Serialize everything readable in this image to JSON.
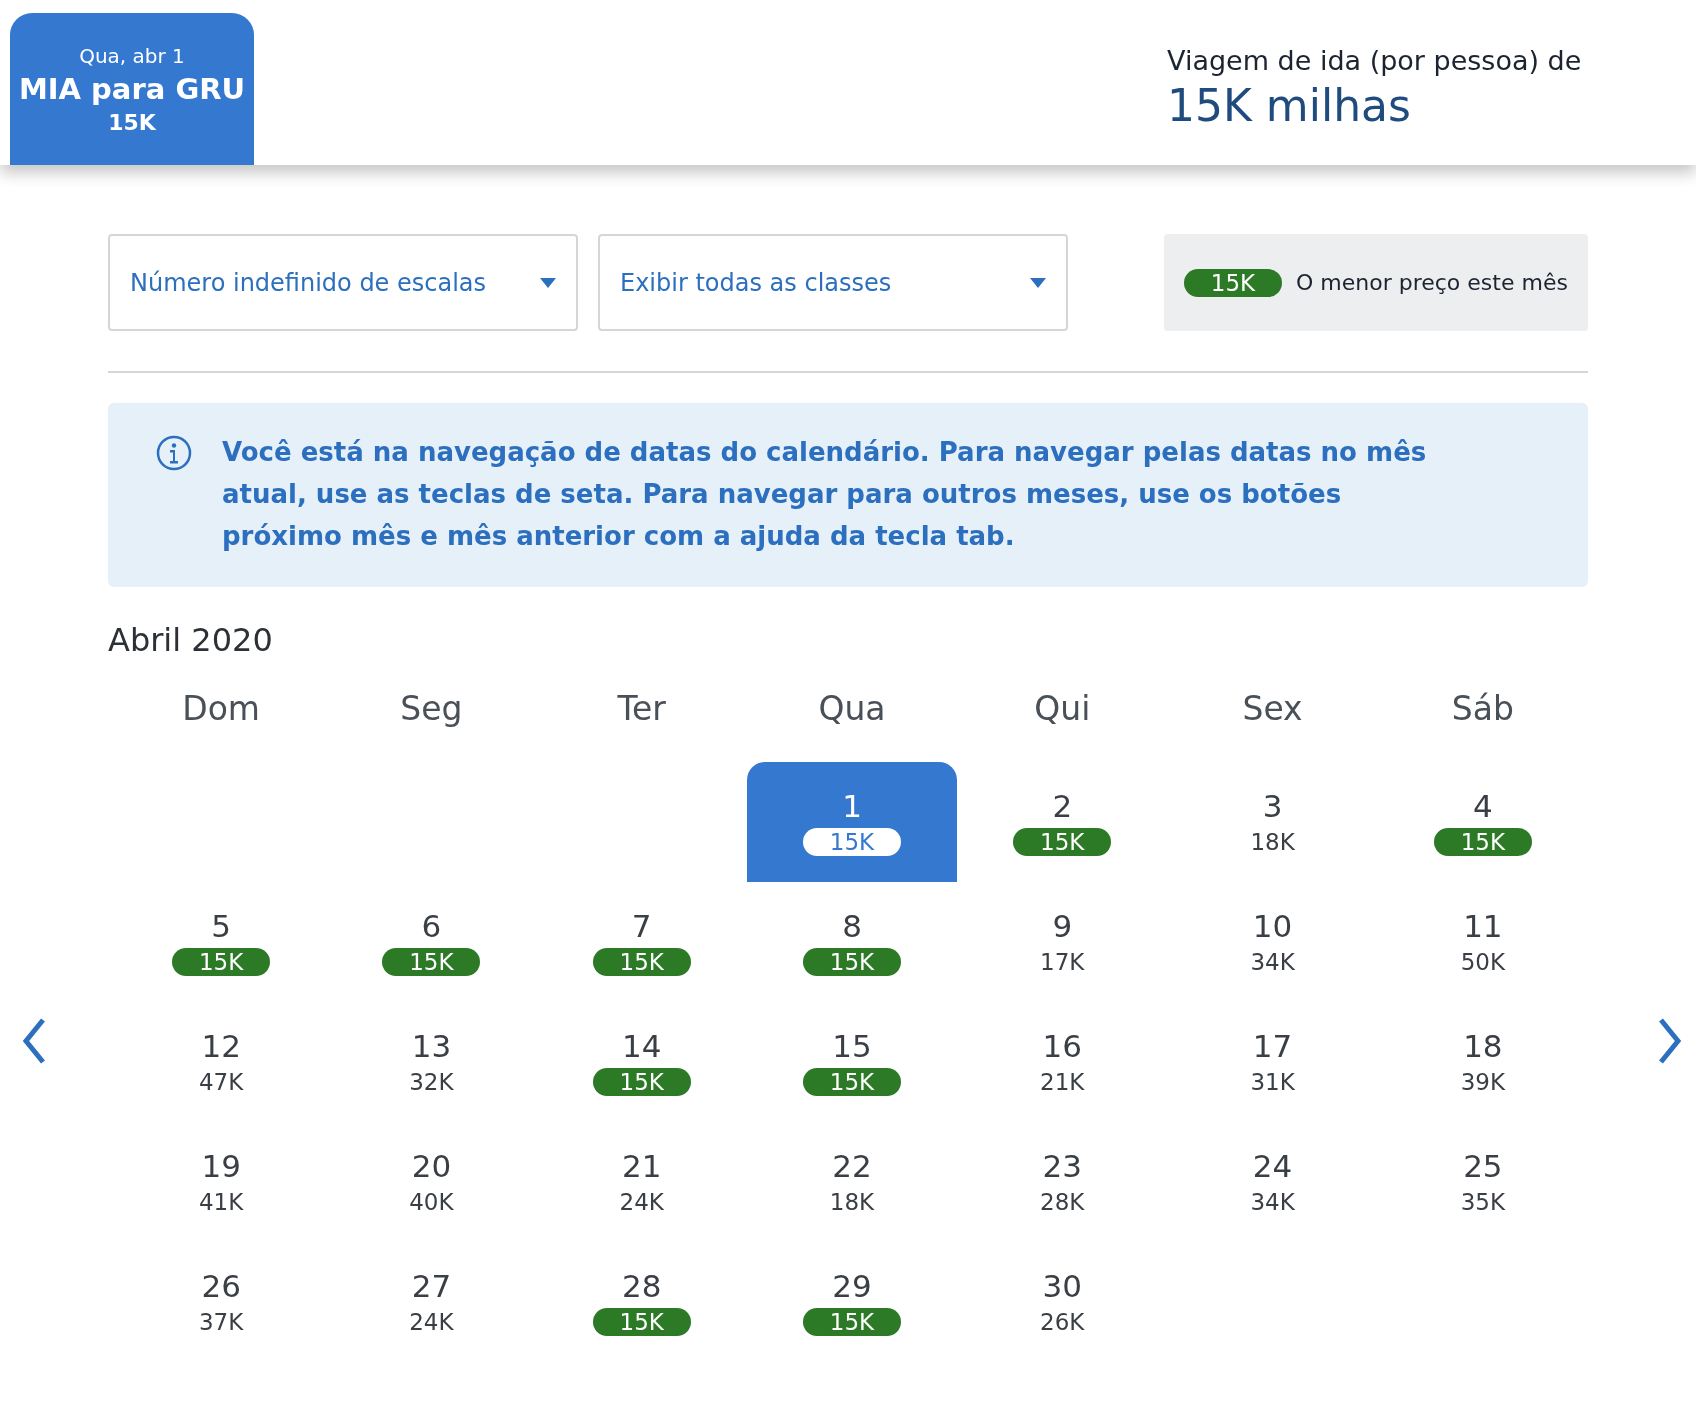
{
  "flight_tab": {
    "date": "Qua, abr 1",
    "route": "MIA para GRU",
    "price": "15K",
    "selected": true
  },
  "fare_summary": {
    "label": "Viagem de ida (por pessoa) de",
    "price": "15K milhas"
  },
  "filters": [
    {
      "value": "Número indefinido de escalas"
    },
    {
      "value": "Exibir todas as classes"
    }
  ],
  "legend": {
    "badge": "15K",
    "text": "O menor preço este mês"
  },
  "info_message": "Você está na navegação de datas do calendário. Para navegar pelas datas no mês atual, use as teclas de seta. Para navegar para outros meses, use os botões próximo mês e mês anterior com a ajuda da tecla tab.",
  "calendar": {
    "month": "Abril 2020",
    "weekdays": [
      "Dom",
      "Seg",
      "Ter",
      "Qua",
      "Qui",
      "Sex",
      "Sáb"
    ],
    "weeks": [
      [
        {
          "kind": "empty"
        },
        {
          "kind": "empty"
        },
        {
          "kind": "empty"
        },
        {
          "kind": "day",
          "day": "1",
          "price": "15K",
          "lowest": true,
          "selected": true
        },
        {
          "kind": "day",
          "day": "2",
          "price": "15K",
          "lowest": true,
          "selected": false
        },
        {
          "kind": "day",
          "day": "3",
          "price": "18K",
          "lowest": false,
          "selected": false
        },
        {
          "kind": "day",
          "day": "4",
          "price": "15K",
          "lowest": true,
          "selected": false
        }
      ],
      [
        {
          "kind": "day",
          "day": "5",
          "price": "15K",
          "lowest": true,
          "selected": false
        },
        {
          "kind": "day",
          "day": "6",
          "price": "15K",
          "lowest": true,
          "selected": false
        },
        {
          "kind": "day",
          "day": "7",
          "price": "15K",
          "lowest": true,
          "selected": false
        },
        {
          "kind": "day",
          "day": "8",
          "price": "15K",
          "lowest": true,
          "selected": false
        },
        {
          "kind": "day",
          "day": "9",
          "price": "17K",
          "lowest": false,
          "selected": false
        },
        {
          "kind": "day",
          "day": "10",
          "price": "34K",
          "lowest": false,
          "selected": false
        },
        {
          "kind": "day",
          "day": "11",
          "price": "50K",
          "lowest": false,
          "selected": false
        }
      ],
      [
        {
          "kind": "day",
          "day": "12",
          "price": "47K",
          "lowest": false,
          "selected": false
        },
        {
          "kind": "day",
          "day": "13",
          "price": "32K",
          "lowest": false,
          "selected": false
        },
        {
          "kind": "day",
          "day": "14",
          "price": "15K",
          "lowest": true,
          "selected": false
        },
        {
          "kind": "day",
          "day": "15",
          "price": "15K",
          "lowest": true,
          "selected": false
        },
        {
          "kind": "day",
          "day": "16",
          "price": "21K",
          "lowest": false,
          "selected": false
        },
        {
          "kind": "day",
          "day": "17",
          "price": "31K",
          "lowest": false,
          "selected": false
        },
        {
          "kind": "day",
          "day": "18",
          "price": "39K",
          "lowest": false,
          "selected": false
        }
      ],
      [
        {
          "kind": "day",
          "day": "19",
          "price": "41K",
          "lowest": false,
          "selected": false
        },
        {
          "kind": "day",
          "day": "20",
          "price": "40K",
          "lowest": false,
          "selected": false
        },
        {
          "kind": "day",
          "day": "21",
          "price": "24K",
          "lowest": false,
          "selected": false
        },
        {
          "kind": "day",
          "day": "22",
          "price": "18K",
          "lowest": false,
          "selected": false
        },
        {
          "kind": "day",
          "day": "23",
          "price": "28K",
          "lowest": false,
          "selected": false
        },
        {
          "kind": "day",
          "day": "24",
          "price": "34K",
          "lowest": false,
          "selected": false
        },
        {
          "kind": "day",
          "day": "25",
          "price": "35K",
          "lowest": false,
          "selected": false
        }
      ],
      [
        {
          "kind": "day",
          "day": "26",
          "price": "37K",
          "lowest": false,
          "selected": false
        },
        {
          "kind": "day",
          "day": "27",
          "price": "24K",
          "lowest": false,
          "selected": false
        },
        {
          "kind": "day",
          "day": "28",
          "price": "15K",
          "lowest": true,
          "selected": false
        },
        {
          "kind": "day",
          "day": "29",
          "price": "15K",
          "lowest": true,
          "selected": false
        },
        {
          "kind": "day",
          "day": "30",
          "price": "26K",
          "lowest": false,
          "selected": false
        },
        {
          "kind": "empty"
        },
        {
          "kind": "empty"
        }
      ]
    ]
  }
}
